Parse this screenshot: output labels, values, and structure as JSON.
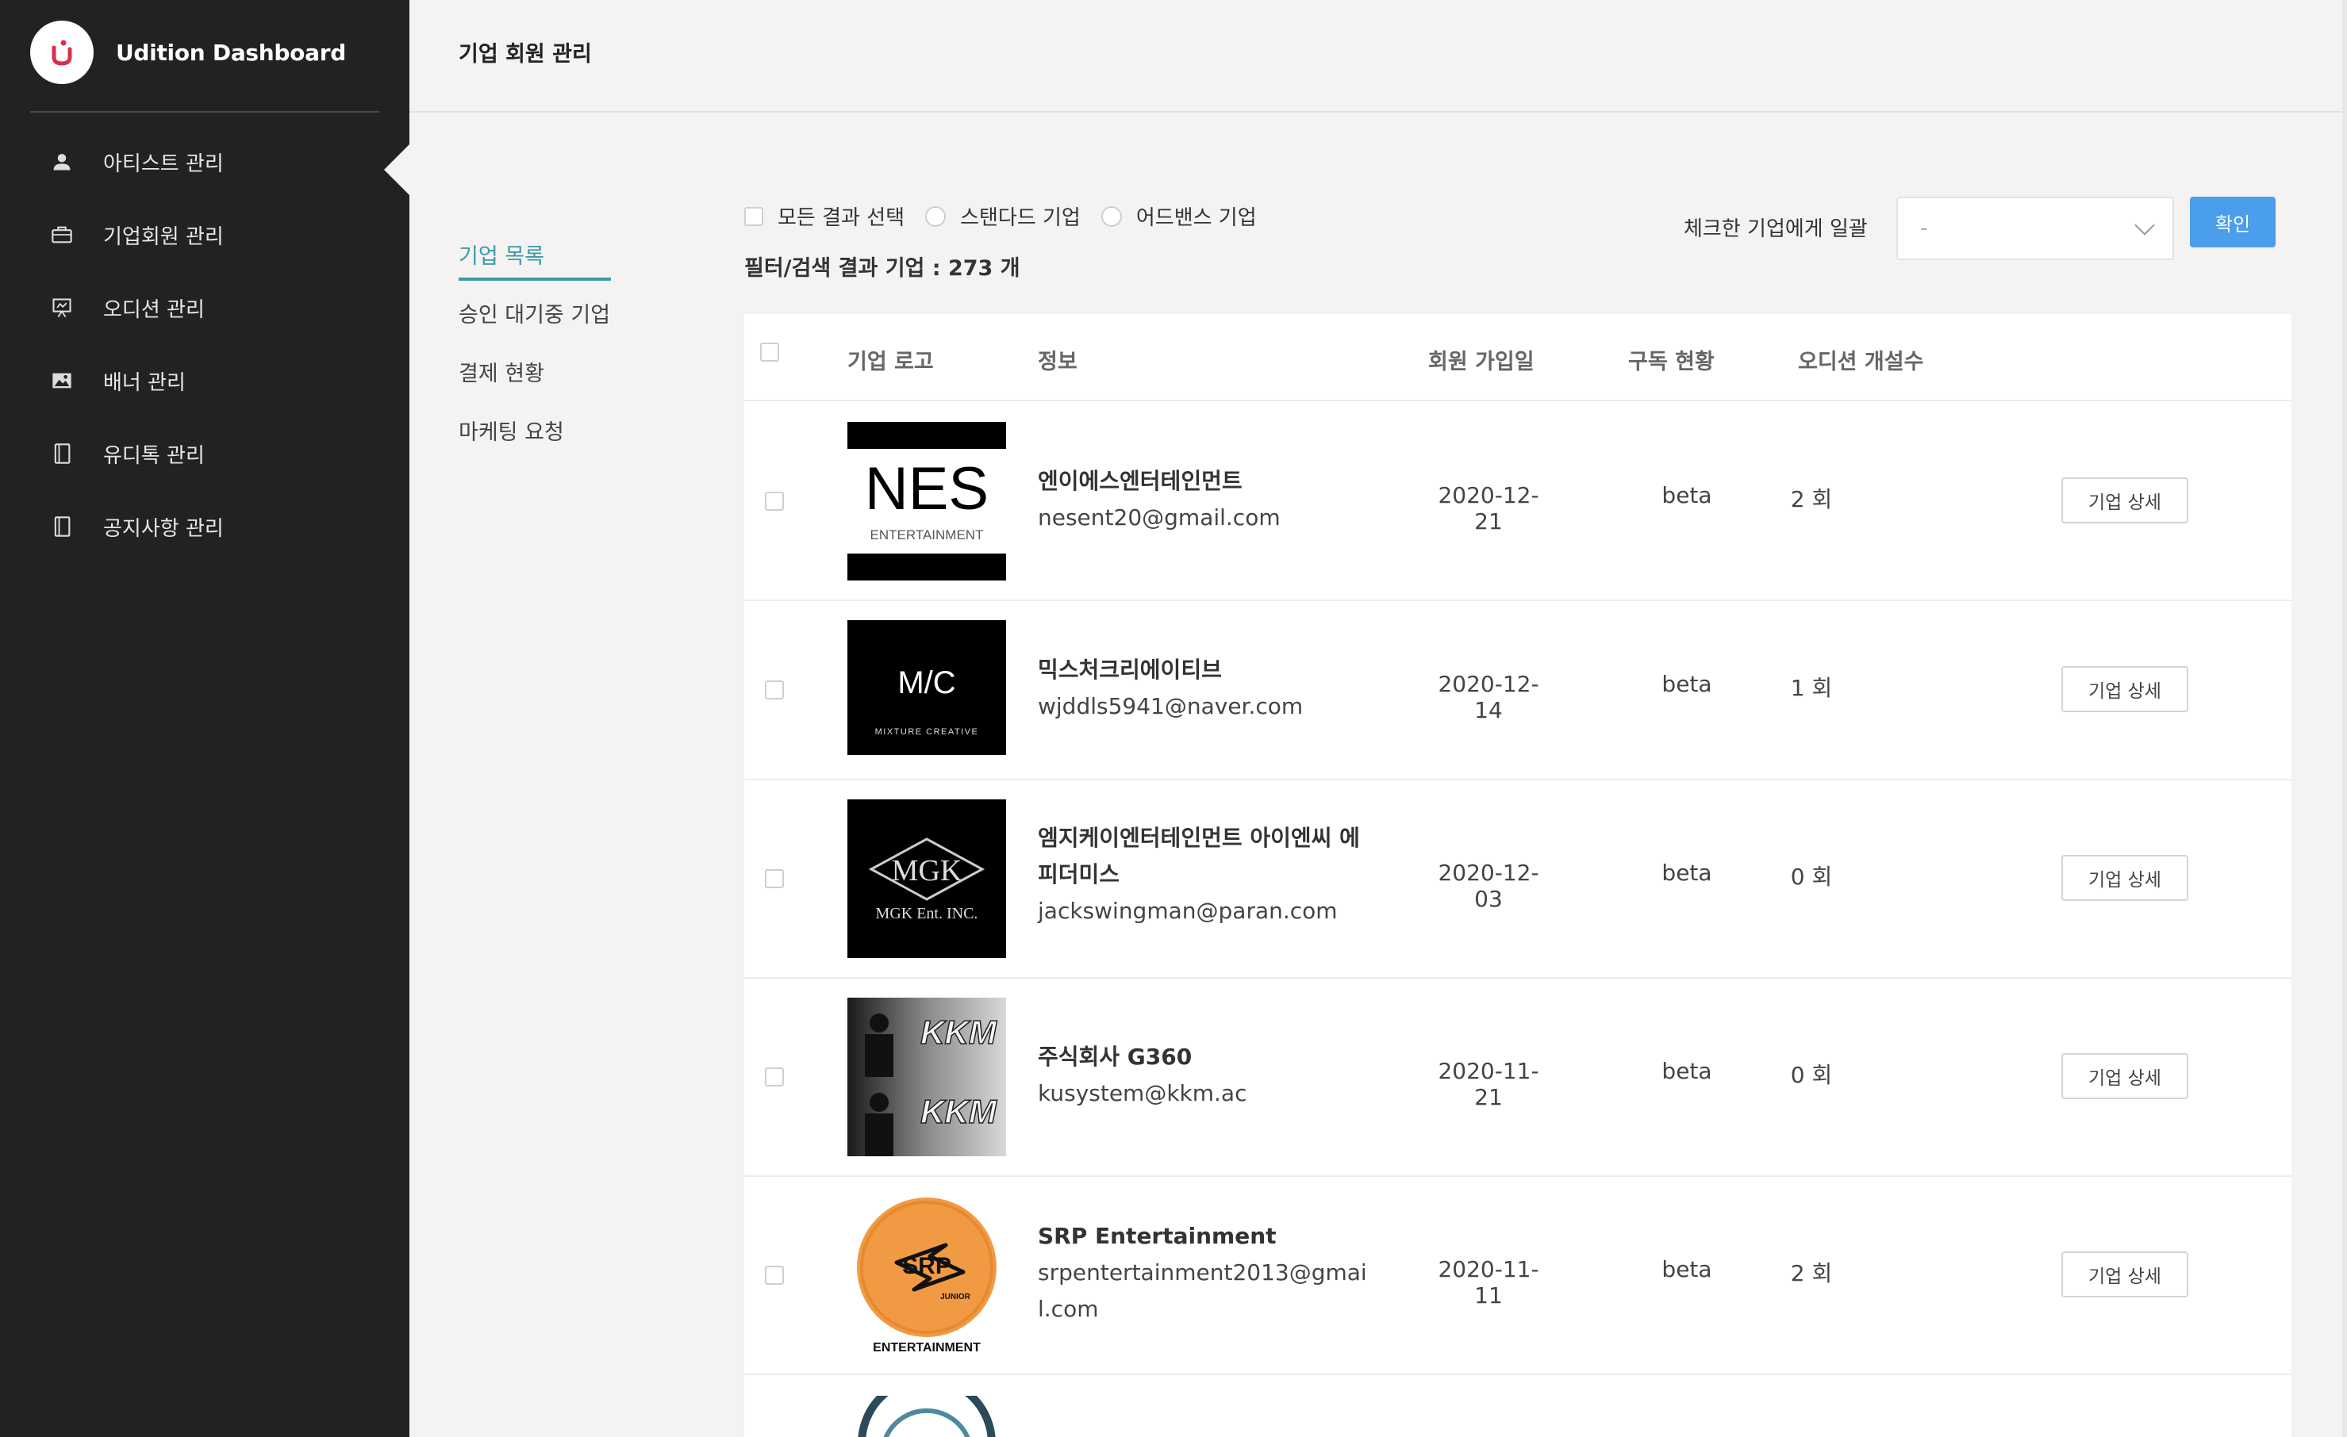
{
  "app": {
    "title": "Udition Dashboard"
  },
  "sidebar": {
    "items": [
      {
        "label": "아티스트 관리",
        "icon": "person-icon"
      },
      {
        "label": "기업회원 관리",
        "icon": "briefcase-icon"
      },
      {
        "label": "오디션 관리",
        "icon": "presentation-icon"
      },
      {
        "label": "배너 관리",
        "icon": "image-icon"
      },
      {
        "label": "유디톡 관리",
        "icon": "notebook-icon"
      },
      {
        "label": "공지사항 관리",
        "icon": "notebook-icon"
      }
    ]
  },
  "header": {
    "title": "기업 회원 관리"
  },
  "submenu": {
    "items": [
      {
        "label": "기업 목록",
        "active": true
      },
      {
        "label": "승인 대기중 기업",
        "active": false
      },
      {
        "label": "결제 현황",
        "active": false
      },
      {
        "label": "마케팅 요청",
        "active": false
      }
    ]
  },
  "filters": {
    "select_all": "모든 결과 선택",
    "standard": "스탠다드 기업",
    "audience": "어드밴스 기업",
    "result_count": "필터/검색 결과 기업 : 273 개"
  },
  "bulk": {
    "label": "체크한 기업에게 일괄",
    "selected": "-",
    "confirm": "확인"
  },
  "table": {
    "headers": {
      "logo": "기업 로고",
      "info": "정보",
      "joined": "회원 가입일",
      "subscription": "구독 현황",
      "auditions": "오디션 개설수"
    },
    "rows": [
      {
        "name": "엔이에스엔터테인먼트",
        "email": "nesent20@gmail.com",
        "joined": "2020-12-21",
        "subscription": "beta",
        "auditions": "2 회",
        "detail": "기업 상세",
        "logo_main": "NES",
        "logo_sub": "ENTERTAINMENT"
      },
      {
        "name": "믹스처크리에이티브",
        "email": "wjddls5941@naver.com",
        "joined": "2020-12-14",
        "subscription": "beta",
        "auditions": "1 회",
        "detail": "기업 상세",
        "logo_main": "M/C",
        "logo_sub": "MIXTURE CREATIVE"
      },
      {
        "name": "엠지케이엔터테인먼트 아이엔씨 에피더미스",
        "email": "jackswingman@paran.com",
        "joined": "2020-12-03",
        "subscription": "beta",
        "auditions": "0 회",
        "detail": "기업 상세",
        "logo_main": "MGK",
        "logo_sub": "MGK Ent. INC."
      },
      {
        "name": "주식회사 G360",
        "email": "kusystem@kkm.ac",
        "joined": "2020-11-21",
        "subscription": "beta",
        "auditions": "0 회",
        "detail": "기업 상세",
        "logo_main": "KKM",
        "logo_sub": "KKM"
      },
      {
        "name": "SRP Entertainment",
        "email": "srpentertainment2013@gmail.com",
        "joined": "2020-11-11",
        "subscription": "beta",
        "auditions": "2 회",
        "detail": "기업 상세",
        "logo_main": "SRP",
        "logo_sub": "ENTERTAINMENT",
        "logo_tag": "JUNIOR"
      }
    ]
  },
  "colors": {
    "sidebar": "#222222",
    "accent": "#3c9aa6",
    "primary_button": "#4a9eec",
    "brand_red": "#d9304a"
  }
}
